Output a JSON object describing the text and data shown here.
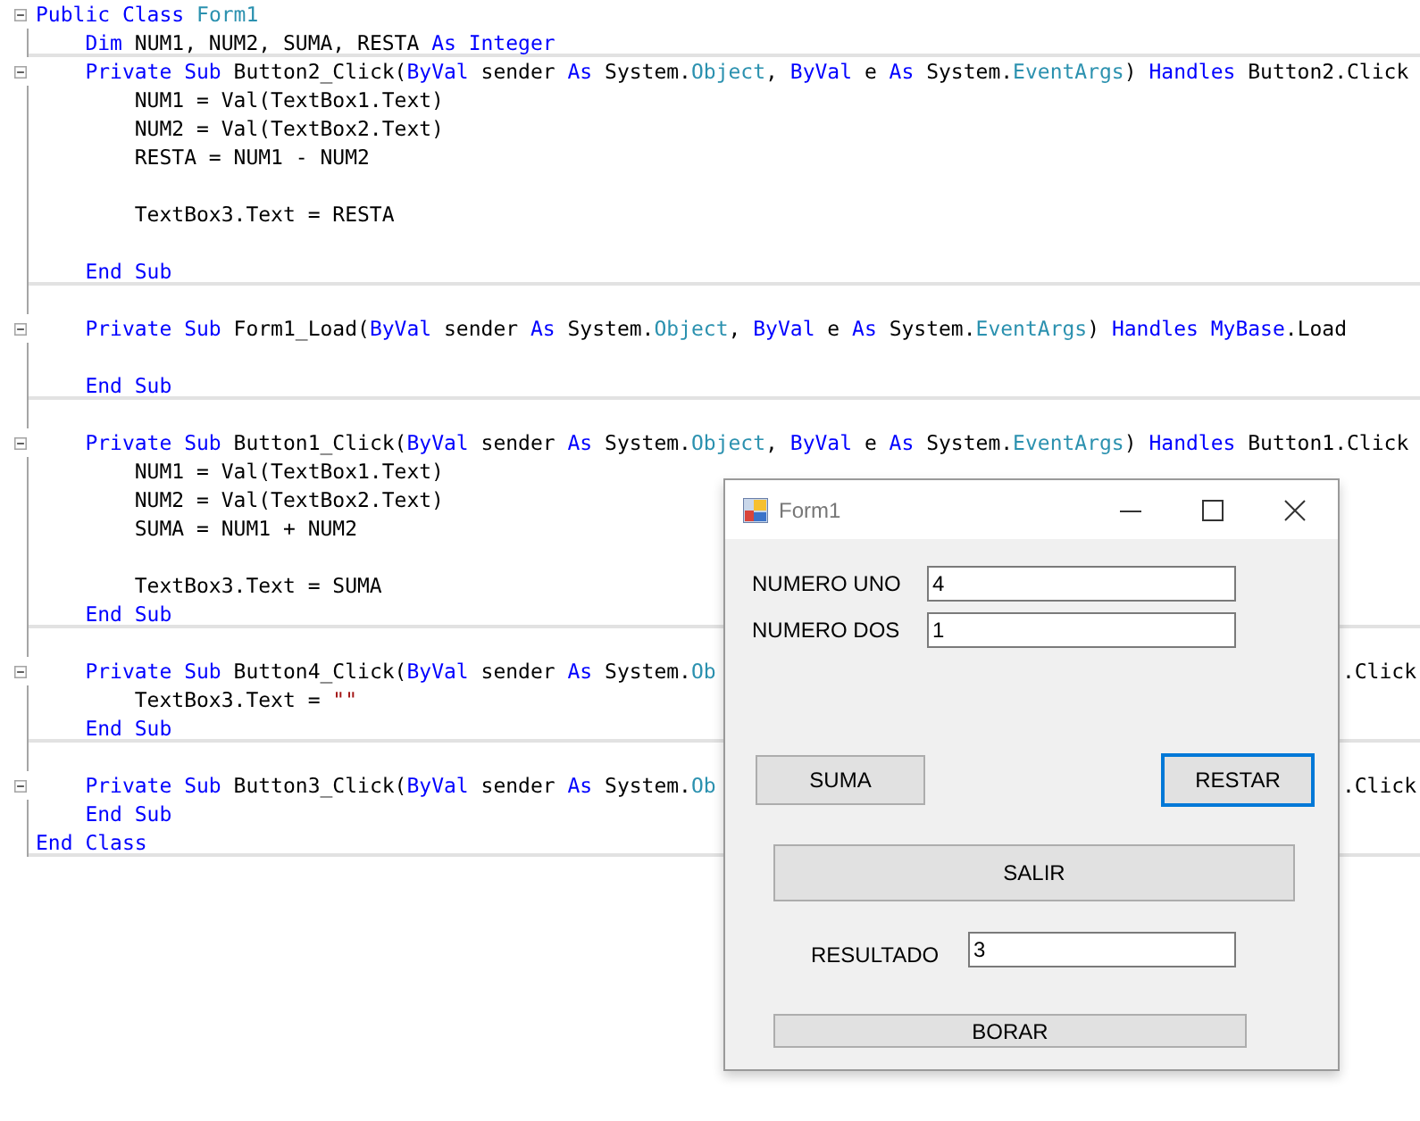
{
  "editor": {
    "lines": [
      {
        "fold": true,
        "separator": false,
        "tokens": [
          {
            "text": "Public Class ",
            "kind": "keyword"
          },
          {
            "text": "Form1",
            "kind": "type"
          }
        ]
      },
      {
        "fold": false,
        "separator": true,
        "tokens": [
          {
            "text": "    Dim",
            "kind": "keyword"
          },
          {
            "text": " NUM1, NUM2, SUMA, RESTA ",
            "kind": "plain"
          },
          {
            "text": "As Integer",
            "kind": "keyword"
          }
        ]
      },
      {
        "fold": true,
        "separator": false,
        "tokens": [
          {
            "text": "    Private Sub",
            "kind": "keyword"
          },
          {
            "text": " Button2_Click(",
            "kind": "plain"
          },
          {
            "text": "ByVal",
            "kind": "keyword"
          },
          {
            "text": " sender ",
            "kind": "plain"
          },
          {
            "text": "As",
            "kind": "keyword"
          },
          {
            "text": " System.",
            "kind": "plain"
          },
          {
            "text": "Object",
            "kind": "type"
          },
          {
            "text": ", ",
            "kind": "plain"
          },
          {
            "text": "ByVal",
            "kind": "keyword"
          },
          {
            "text": " e ",
            "kind": "plain"
          },
          {
            "text": "As",
            "kind": "keyword"
          },
          {
            "text": " System.",
            "kind": "plain"
          },
          {
            "text": "EventArgs",
            "kind": "type"
          },
          {
            "text": ") ",
            "kind": "plain"
          },
          {
            "text": "Handles",
            "kind": "keyword"
          },
          {
            "text": " Button2.Click",
            "kind": "plain"
          }
        ]
      },
      {
        "fold": false,
        "separator": false,
        "tokens": [
          {
            "text": "        NUM1 = Val(TextBox1.Text)",
            "kind": "plain"
          }
        ]
      },
      {
        "fold": false,
        "separator": false,
        "tokens": [
          {
            "text": "        NUM2 = Val(TextBox2.Text)",
            "kind": "plain"
          }
        ]
      },
      {
        "fold": false,
        "separator": false,
        "tokens": [
          {
            "text": "        RESTA = NUM1 - NUM2",
            "kind": "plain"
          }
        ]
      },
      {
        "fold": false,
        "separator": false
      },
      {
        "fold": false,
        "separator": false,
        "tokens": [
          {
            "text": "        TextBox3.Text = RESTA",
            "kind": "plain"
          }
        ]
      },
      {
        "fold": false,
        "separator": false
      },
      {
        "fold": false,
        "separator": true,
        "tokens": [
          {
            "text": "    End Sub",
            "kind": "keyword"
          }
        ]
      },
      {
        "fold": false,
        "separator": false
      },
      {
        "fold": true,
        "separator": false,
        "tokens": [
          {
            "text": "    Private Sub",
            "kind": "keyword"
          },
          {
            "text": " Form1_Load(",
            "kind": "plain"
          },
          {
            "text": "ByVal",
            "kind": "keyword"
          },
          {
            "text": " sender ",
            "kind": "plain"
          },
          {
            "text": "As",
            "kind": "keyword"
          },
          {
            "text": " System.",
            "kind": "plain"
          },
          {
            "text": "Object",
            "kind": "type"
          },
          {
            "text": ", ",
            "kind": "plain"
          },
          {
            "text": "ByVal",
            "kind": "keyword"
          },
          {
            "text": " e ",
            "kind": "plain"
          },
          {
            "text": "As",
            "kind": "keyword"
          },
          {
            "text": " System.",
            "kind": "plain"
          },
          {
            "text": "EventArgs",
            "kind": "type"
          },
          {
            "text": ") ",
            "kind": "plain"
          },
          {
            "text": "Handles MyBase",
            "kind": "keyword"
          },
          {
            "text": ".Load",
            "kind": "plain"
          }
        ]
      },
      {
        "fold": false,
        "separator": false
      },
      {
        "fold": false,
        "separator": true,
        "tokens": [
          {
            "text": "    End Sub",
            "kind": "keyword"
          }
        ]
      },
      {
        "fold": false,
        "separator": false
      },
      {
        "fold": true,
        "separator": false,
        "tokens": [
          {
            "text": "    Private Sub",
            "kind": "keyword"
          },
          {
            "text": " Button1_Click(",
            "kind": "plain"
          },
          {
            "text": "ByVal",
            "kind": "keyword"
          },
          {
            "text": " sender ",
            "kind": "plain"
          },
          {
            "text": "As",
            "kind": "keyword"
          },
          {
            "text": " System.",
            "kind": "plain"
          },
          {
            "text": "Object",
            "kind": "type"
          },
          {
            "text": ", ",
            "kind": "plain"
          },
          {
            "text": "ByVal",
            "kind": "keyword"
          },
          {
            "text": " e ",
            "kind": "plain"
          },
          {
            "text": "As",
            "kind": "keyword"
          },
          {
            "text": " System.",
            "kind": "plain"
          },
          {
            "text": "EventArgs",
            "kind": "type"
          },
          {
            "text": ") ",
            "kind": "plain"
          },
          {
            "text": "Handles",
            "kind": "keyword"
          },
          {
            "text": " Button1.Click",
            "kind": "plain"
          }
        ]
      },
      {
        "fold": false,
        "separator": false,
        "tokens": [
          {
            "text": "        NUM1 = Val(TextBox1.Text)",
            "kind": "plain"
          }
        ]
      },
      {
        "fold": false,
        "separator": false,
        "tokens": [
          {
            "text": "        NUM2 = Val(TextBox2.Text)",
            "kind": "plain"
          }
        ]
      },
      {
        "fold": false,
        "separator": false,
        "tokens": [
          {
            "text": "        SUMA = NUM1 + NUM2",
            "kind": "plain"
          }
        ]
      },
      {
        "fold": false,
        "separator": false
      },
      {
        "fold": false,
        "separator": false,
        "tokens": [
          {
            "text": "        TextBox3.Text = SUMA",
            "kind": "plain"
          }
        ]
      },
      {
        "fold": false,
        "separator": true,
        "tokens": [
          {
            "text": "    End Sub",
            "kind": "keyword"
          }
        ]
      },
      {
        "fold": false,
        "separator": false
      },
      {
        "fold": true,
        "separator": false,
        "tokens": [
          {
            "text": "    Private Sub",
            "kind": "keyword"
          },
          {
            "text": " Button4_Click(",
            "kind": "plain"
          },
          {
            "text": "ByVal",
            "kind": "keyword"
          },
          {
            "text": " sender ",
            "kind": "plain"
          },
          {
            "text": "As",
            "kind": "keyword"
          },
          {
            "text": " System.",
            "kind": "plain"
          },
          {
            "text": "Ob",
            "kind": "type"
          }
        ],
        "tokens_right": [
          {
            "text": ".Click",
            "kind": "plain"
          }
        ]
      },
      {
        "fold": false,
        "separator": false,
        "tokens": [
          {
            "text": "        TextBox3.Text = ",
            "kind": "plain"
          },
          {
            "text": "\"\"",
            "kind": "string"
          }
        ]
      },
      {
        "fold": false,
        "separator": true,
        "tokens": [
          {
            "text": "    End Sub",
            "kind": "keyword"
          }
        ]
      },
      {
        "fold": false,
        "separator": false
      },
      {
        "fold": true,
        "separator": false,
        "tokens": [
          {
            "text": "    Private Sub",
            "kind": "keyword"
          },
          {
            "text": " Button3_Click(",
            "kind": "plain"
          },
          {
            "text": "ByVal",
            "kind": "keyword"
          },
          {
            "text": " sender ",
            "kind": "plain"
          },
          {
            "text": "As",
            "kind": "keyword"
          },
          {
            "text": " System.",
            "kind": "plain"
          },
          {
            "text": "Ob",
            "kind": "type"
          }
        ],
        "tokens_right": [
          {
            "text": ".Click",
            "kind": "plain"
          }
        ]
      },
      {
        "fold": false,
        "separator": false,
        "tokens": [
          {
            "text": "    End Sub",
            "kind": "keyword"
          }
        ]
      },
      {
        "fold": false,
        "separator": true,
        "tokens": [
          {
            "text": "End Class",
            "kind": "keyword"
          }
        ]
      }
    ]
  },
  "form_window": {
    "title": "Form1",
    "inputs": [
      {
        "label": "NUMERO UNO",
        "value": "4"
      },
      {
        "label": "NUMERO DOS",
        "value": "1"
      }
    ],
    "operation_buttons": [
      {
        "label": "SUMA",
        "focused": false
      },
      {
        "label": "RESTAR",
        "focused": true
      }
    ],
    "exit_button": {
      "label": "SALIR",
      "focused": false
    },
    "result": {
      "label": "RESULTADO",
      "value": "3"
    },
    "clear_button": {
      "label": "BORAR",
      "focused": false
    }
  }
}
